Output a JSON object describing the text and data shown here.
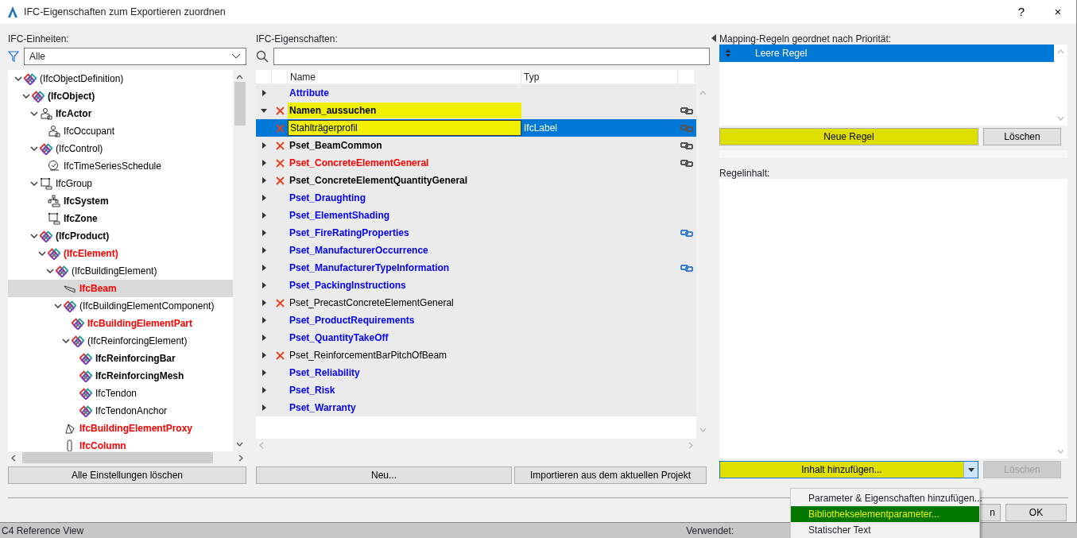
{
  "window": {
    "title": "IFC-Eigenschaften zum Exportieren zuordnen",
    "controls": [
      "?",
      "×"
    ]
  },
  "units": {
    "label": "IFC-Einheiten:",
    "filter": "Alle",
    "button": "Alle Einstellungen löschen",
    "tree": [
      {
        "label": "(IfcObjectDefinition)",
        "kind": "ifc",
        "color": "#000000",
        "bold": false,
        "expanded": true,
        "selected": false,
        "children": [
          {
            "label": "(IfcObject)",
            "kind": "ifc",
            "color": "#000000",
            "bold": true,
            "expanded": true,
            "selected": false,
            "children": [
              {
                "label": "IfcActor",
                "kind": "actor",
                "color": "#000000",
                "bold": true,
                "expanded": true,
                "selected": false,
                "children": [
                  {
                    "label": "IfcOccupant",
                    "kind": "actor",
                    "color": "#000000",
                    "bold": false,
                    "selected": false
                  }
                ]
              },
              {
                "label": "(IfcControl)",
                "kind": "ifc",
                "color": "#000000",
                "bold": false,
                "expanded": true,
                "selected": false,
                "children": [
                  {
                    "label": "IfcTimeSeriesSchedule",
                    "kind": "schedule",
                    "color": "#000000",
                    "bold": false,
                    "selected": false
                  }
                ]
              },
              {
                "label": "IfcGroup",
                "kind": "group",
                "color": "#000000",
                "bold": false,
                "expanded": true,
                "selected": false,
                "children": [
                  {
                    "label": "IfcSystem",
                    "kind": "system",
                    "color": "#000000",
                    "bold": true,
                    "selected": false
                  },
                  {
                    "label": "IfcZone",
                    "kind": "group",
                    "color": "#000000",
                    "bold": true,
                    "selected": false
                  }
                ]
              },
              {
                "label": "(IfcProduct)",
                "kind": "ifc",
                "color": "#000000",
                "bold": true,
                "expanded": true,
                "selected": false,
                "children": [
                  {
                    "label": "(IfcElement)",
                    "kind": "ifc",
                    "color": "#ff0000",
                    "bold": true,
                    "expanded": true,
                    "selected": false,
                    "children": [
                      {
                        "label": "(IfcBuildingElement)",
                        "kind": "ifc",
                        "color": "#000000",
                        "bold": false,
                        "expanded": true,
                        "selected": false,
                        "children": [
                          {
                            "label": "IfcBeam",
                            "kind": "beam",
                            "color": "#ff0000",
                            "bold": true,
                            "selected": true
                          },
                          {
                            "label": "(IfcBuildingElementComponent)",
                            "kind": "ifc",
                            "color": "#000000",
                            "bold": false,
                            "expanded": true,
                            "selected": false,
                            "children": [
                              {
                                "label": "IfcBuildingElementPart",
                                "kind": "ifc",
                                "color": "#ff0000",
                                "bold": true,
                                "selected": false
                              },
                              {
                                "label": "(IfcReinforcingElement)",
                                "kind": "ifc",
                                "color": "#000000",
                                "bold": false,
                                "expanded": true,
                                "selected": false,
                                "children": [
                                  {
                                    "label": "IfcReinforcingBar",
                                    "kind": "ifc",
                                    "color": "#000000",
                                    "bold": true,
                                    "selected": false
                                  },
                                  {
                                    "label": "IfcReinforcingMesh",
                                    "kind": "ifc",
                                    "color": "#000000",
                                    "bold": true,
                                    "selected": false
                                  },
                                  {
                                    "label": "IfcTendon",
                                    "kind": "ifc",
                                    "color": "#000000",
                                    "bold": false,
                                    "selected": false
                                  },
                                  {
                                    "label": "IfcTendonAnchor",
                                    "kind": "ifc",
                                    "color": "#000000",
                                    "bold": false,
                                    "selected": false
                                  }
                                ]
                              }
                            ]
                          },
                          {
                            "label": "IfcBuildingElementProxy",
                            "kind": "proxy",
                            "color": "#ff0000",
                            "bold": true,
                            "selected": false
                          },
                          {
                            "label": "IfcColumn",
                            "kind": "column",
                            "color": "#ff0000",
                            "bold": true,
                            "selected": false
                          }
                        ]
                      }
                    ]
                  }
                ]
              }
            ]
          }
        ]
      }
    ]
  },
  "properties": {
    "label": "IFC-Eigenschaften:",
    "columns": [
      "Name",
      "Typ"
    ],
    "buttons": [
      "Neu...",
      "Importieren aus dem aktuellen Projekt"
    ],
    "rows": [
      {
        "name": "Attribute",
        "color": "#0000ff",
        "bold": true,
        "expanded": false,
        "excluded": false,
        "selected": false,
        "highlighted": false
      },
      {
        "name": "Namen_aussuchen",
        "color": "#000000",
        "bold": true,
        "expanded": true,
        "excluded": true,
        "link": {
          "color": "#555555"
        },
        "selected": false,
        "highlighted": true,
        "children": [
          {
            "name": "Stahlträgerprofil",
            "type": "IfcLabel",
            "color": "#000000",
            "bold": false,
            "excluded": true,
            "link": {
              "color": "#555555"
            },
            "selected": true,
            "highlighted": true
          }
        ]
      },
      {
        "name": "Pset_BeamCommon",
        "color": "#000000",
        "bold": true,
        "expanded": false,
        "excluded": true,
        "link": {
          "color": "#555555"
        },
        "selected": false,
        "highlighted": false
      },
      {
        "name": "Pset_ConcreteElementGeneral",
        "color": "#ff0000",
        "bold": true,
        "expanded": false,
        "excluded": true,
        "link": {
          "color": "#555555"
        },
        "selected": false,
        "highlighted": false
      },
      {
        "name": "Pset_ConcreteElementQuantityGeneral",
        "color": "#000000",
        "bold": true,
        "expanded": false,
        "excluded": true,
        "selected": false,
        "highlighted": false
      },
      {
        "name": "Pset_Draughting",
        "color": "#0000ff",
        "bold": true,
        "expanded": false,
        "excluded": false,
        "selected": false,
        "highlighted": false
      },
      {
        "name": "Pset_ElementShading",
        "color": "#0000ff",
        "bold": true,
        "expanded": false,
        "excluded": false,
        "selected": false,
        "highlighted": false
      },
      {
        "name": "Pset_FireRatingProperties",
        "color": "#0000ff",
        "bold": true,
        "expanded": false,
        "excluded": false,
        "link": {
          "color": "#3a7fd0"
        },
        "selected": false,
        "highlighted": false
      },
      {
        "name": "Pset_ManufacturerOccurrence",
        "color": "#0000ff",
        "bold": true,
        "expanded": false,
        "excluded": false,
        "selected": false,
        "highlighted": false
      },
      {
        "name": "Pset_ManufacturerTypeInformation",
        "color": "#0000ff",
        "bold": true,
        "expanded": false,
        "excluded": false,
        "link": {
          "color": "#3a7fd0"
        },
        "selected": false,
        "highlighted": false
      },
      {
        "name": "Pset_PackingInstructions",
        "color": "#0000ff",
        "bold": true,
        "expanded": false,
        "excluded": false,
        "selected": false,
        "highlighted": false
      },
      {
        "name": "Pset_PrecastConcreteElementGeneral",
        "color": "#000000",
        "bold": false,
        "expanded": false,
        "excluded": true,
        "selected": false,
        "highlighted": false
      },
      {
        "name": "Pset_ProductRequirements",
        "color": "#0000ff",
        "bold": true,
        "expanded": false,
        "excluded": false,
        "selected": false,
        "highlighted": false
      },
      {
        "name": "Pset_QuantityTakeOff",
        "color": "#0000ff",
        "bold": true,
        "expanded": false,
        "excluded": false,
        "selected": false,
        "highlighted": false
      },
      {
        "name": "Pset_ReinforcementBarPitchOfBeam",
        "color": "#000000",
        "bold": false,
        "expanded": false,
        "excluded": true,
        "selected": false,
        "highlighted": false
      },
      {
        "name": "Pset_Reliability",
        "color": "#0000ff",
        "bold": true,
        "expanded": false,
        "excluded": false,
        "selected": false,
        "highlighted": false
      },
      {
        "name": "Pset_Risk",
        "color": "#0000ff",
        "bold": true,
        "expanded": false,
        "excluded": false,
        "selected": false,
        "highlighted": false
      },
      {
        "name": "Pset_Warranty",
        "color": "#0000ff",
        "bold": true,
        "expanded": false,
        "excluded": false,
        "selected": false,
        "highlighted": false
      }
    ]
  },
  "rules": {
    "label": "Mapping-Regeln geordnet nach Priorität:",
    "items": [
      {
        "label": "Leere Regel",
        "selected": true
      }
    ],
    "buttons": [
      {
        "label": "Neue Regel",
        "highlighted": true,
        "disabled": false
      },
      {
        "label": "Löschen",
        "highlighted": false,
        "disabled": false
      }
    ],
    "content_label": "Regelinhalt:",
    "content_buttons": [
      {
        "label": "Inhalt hinzufügen...",
        "kind": "split",
        "highlighted": true,
        "disabled": false
      },
      {
        "label": "Löschen",
        "kind": "plain",
        "highlighted": false,
        "disabled": true
      }
    ],
    "menu": [
      {
        "label": "Parameter & Eigenschaften hinzufügen...",
        "selected": false,
        "highlighted": false
      },
      {
        "label": "Bibliothekselementparameter...",
        "selected": true,
        "highlighted": true
      },
      {
        "label": "Statischer Text",
        "selected": false,
        "highlighted": false
      }
    ]
  },
  "footer": {
    "buttons": [
      "n",
      "OK"
    ]
  },
  "background": {
    "texts": [
      "C4 Reference View",
      "Verwendet:"
    ]
  }
}
